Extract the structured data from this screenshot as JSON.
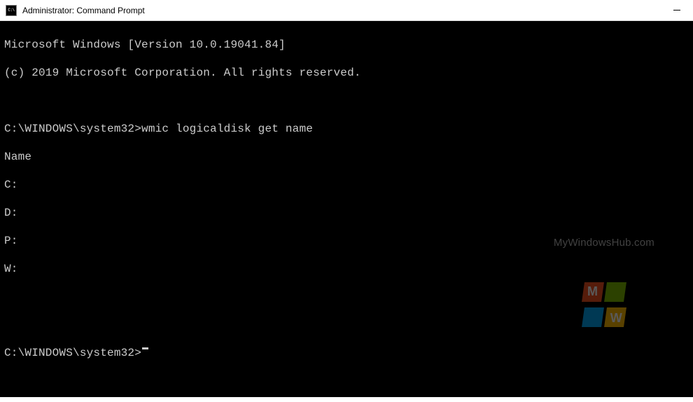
{
  "window": {
    "title": "Administrator: Command Prompt"
  },
  "terminal": {
    "header_line1": "Microsoft Windows [Version 10.0.19041.84]",
    "header_line2": "(c) 2019 Microsoft Corporation. All rights reserved.",
    "prompt": "C:\\WINDOWS\\system32>",
    "command": "wmic logicaldisk get name",
    "output_header": "Name",
    "output_rows": [
      "C:",
      "D:",
      "P:",
      "W:"
    ]
  },
  "watermark": {
    "text": "MyWindowsHub.com",
    "letter_top": "M",
    "letter_bottom": "W"
  }
}
